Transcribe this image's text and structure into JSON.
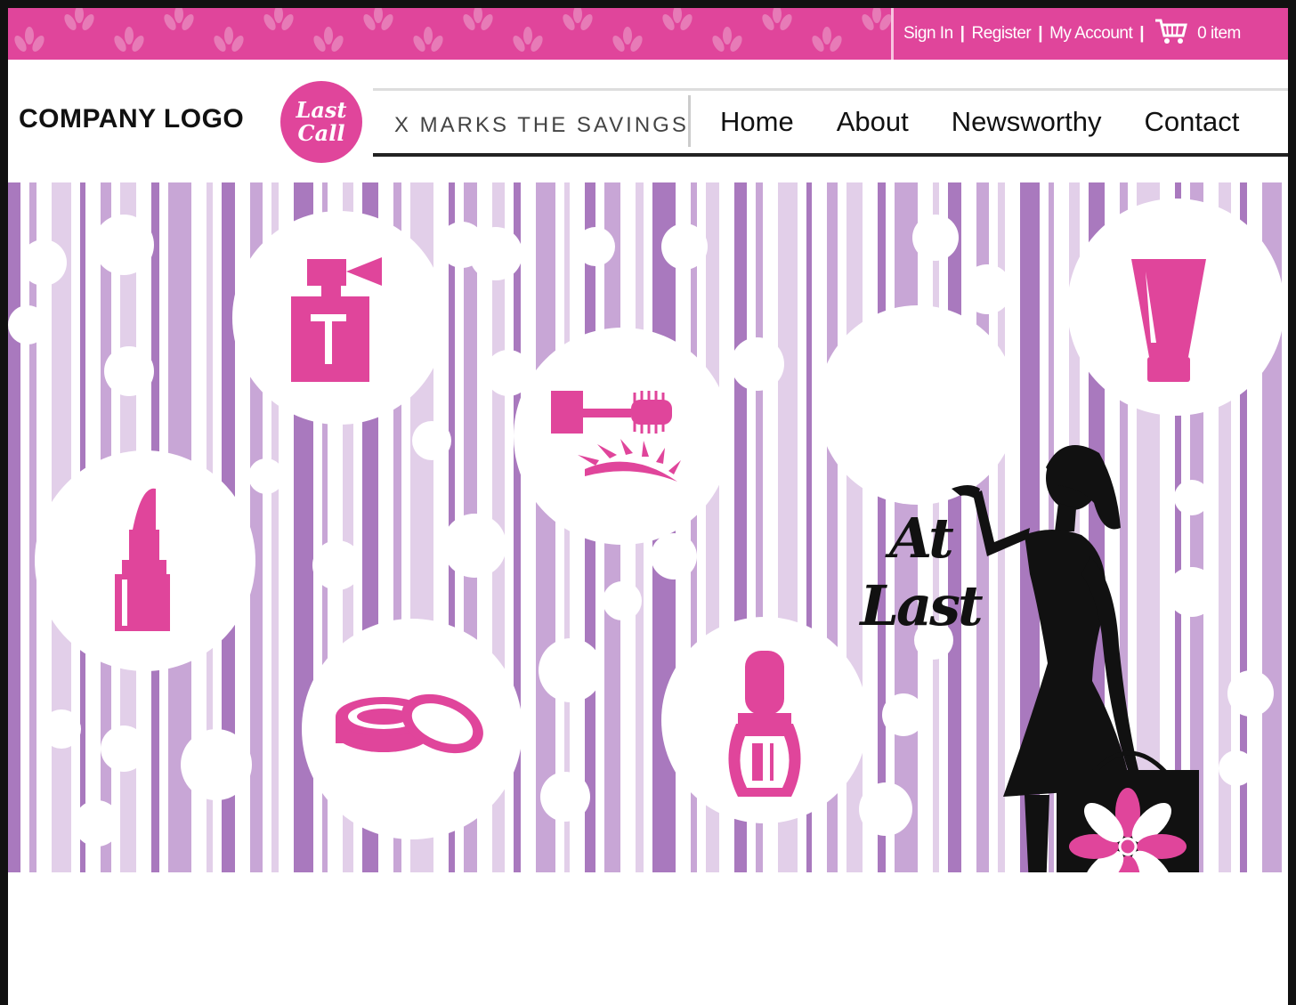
{
  "topbar": {
    "links": [
      "Sign In",
      "Register",
      "My Account"
    ],
    "cart_count": "0 item",
    "color": "#e0459b"
  },
  "header": {
    "logo_text": "COMPANY LOGO",
    "badge_line1": "Last",
    "badge_line2": "Call",
    "tagline": "X MARKS THE SAVINGS",
    "nav": [
      "Home",
      "About",
      "Newsworthy",
      "Contact"
    ]
  },
  "banner": {
    "headline_line1": "At",
    "headline_line2": "Last",
    "stripe_colors": [
      "#a979be",
      "#c8a6d6",
      "#e2cfe9"
    ],
    "icons": [
      "perfume-icon",
      "mascara-icon",
      "lotion-tube-icon",
      "lipstick-icon",
      "compact-powder-icon",
      "nail-polish-icon",
      "woman-silhouette",
      "shopping-bag-icon"
    ],
    "accent_color": "#e0459b"
  }
}
